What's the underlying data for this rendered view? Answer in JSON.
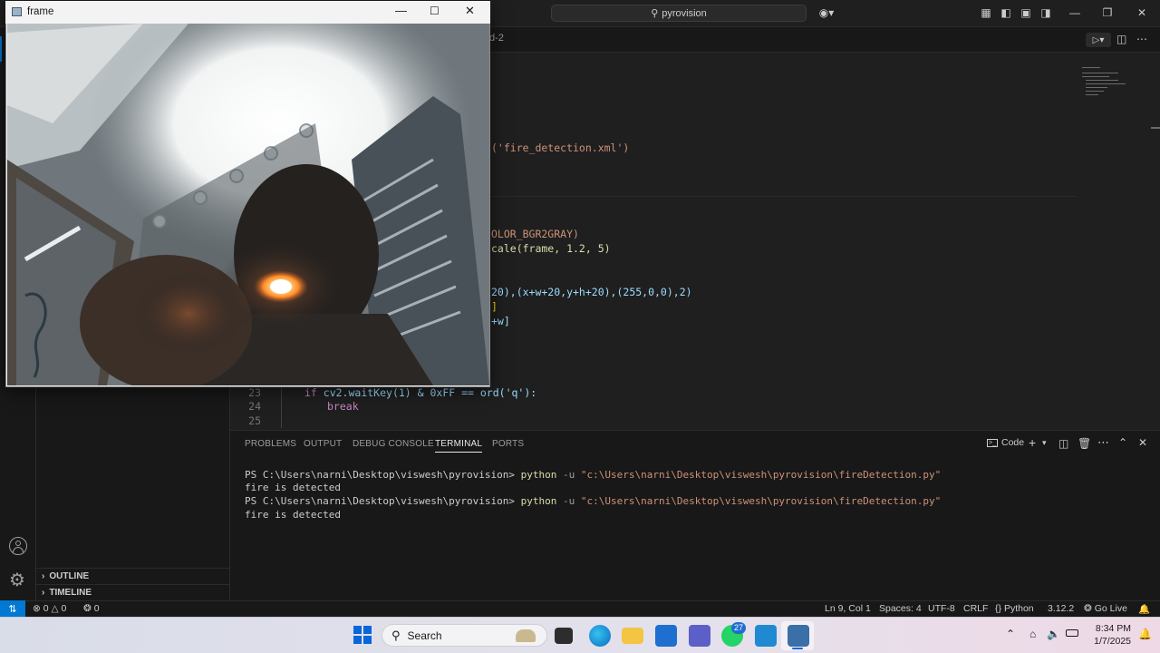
{
  "titlebar": {
    "search_text": "pyrovision"
  },
  "tabs": {
    "fragment": "d-2"
  },
  "sidebar": {
    "outline_label": "OUTLINE",
    "timeline_label": "TIMELINE"
  },
  "editor": {
    "lines": {
      "l_cascade": "('fire_detection.xml')",
      "l_gray": "OLOR_BGR2GRAY)",
      "l_detect_a": "cale(frame, 1.2, 5)",
      "l_rect_a": "20),(x+w+20,y+h+20),(255,0,0),2)",
      "l_roi1": "]",
      "l_roi2": "+w]",
      "ln23": "23",
      "ln24": "24",
      "ln25": "25",
      "code23_kw": "if",
      "code23_rest": " cv2.waitKey(1) & 0xFF == ord('q'):",
      "code24": "break"
    }
  },
  "panel": {
    "tabs": [
      "PROBLEMS",
      "OUTPUT",
      "DEBUG CONSOLE",
      "TERMINAL",
      "PORTS"
    ],
    "active_tab": "TERMINAL",
    "shell_label": "Code",
    "terminal": {
      "prompt1": "PS C:\\Users\\narni\\Desktop\\viswesh\\pyrovision>",
      "cmd1": "python",
      "flag1": "-u",
      "arg1": "\"c:\\Users\\narni\\Desktop\\viswesh\\pyrovision\\fireDetection.py\"",
      "out1": "fire is detected",
      "prompt2": "PS C:\\Users\\narni\\Desktop\\viswesh\\pyrovision>",
      "cmd2": "python",
      "flag2": "-u",
      "arg2": "\"c:\\Users\\narni\\Desktop\\viswesh\\pyrovision\\fireDetection.py\"",
      "out2": "fire is detected"
    }
  },
  "statusbar": {
    "errors": "0",
    "warnings": "0",
    "ports": "0",
    "position": "Ln 9, Col 1",
    "spaces": "Spaces: 4",
    "encoding": "UTF-8",
    "eol": "CRLF",
    "language": "Python",
    "version": "3.12.2",
    "golive": "Go Live"
  },
  "camera_window": {
    "title": "frame"
  },
  "taskbar": {
    "search_label": "Search",
    "whatsapp_badge": "27",
    "time": "8:34 PM",
    "date": "1/7/2025"
  },
  "colors": {
    "accent": "#0078d4",
    "editor_bg": "#1f1f1f",
    "panel_bg": "#181818"
  }
}
